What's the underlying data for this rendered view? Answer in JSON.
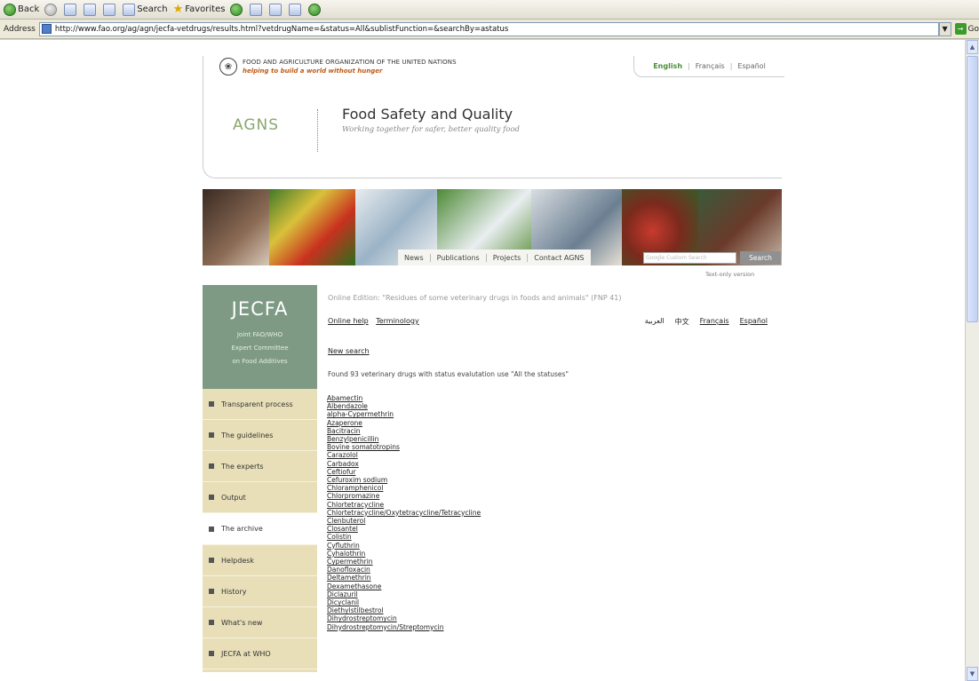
{
  "browser": {
    "back_label": "Back",
    "search_label": "Search",
    "favorites_label": "Favorites",
    "address_label": "Address",
    "url": "http://www.fao.org/ag/agn/jecfa-vetdrugs/results.html?vetdrugName=&status=All&sublistFunction=&searchBy=astatus",
    "go_label": "Go",
    "colors": {
      "toolbar": "#ece9d8",
      "go": "#3b9b2b"
    }
  },
  "header": {
    "org_name": "FOOD AND AGRICULTURE ORGANIZATION OF THE UNITED NATIONS",
    "org_tagline": "helping to build a world without hunger",
    "section_logo": "AGNS",
    "title": "Food Safety and Quality",
    "subtitle": "Working together for safer, better quality food",
    "languages": [
      "English",
      "Français",
      "Español"
    ]
  },
  "nav": {
    "items": [
      "News",
      "Publications",
      "Projects",
      "Contact AGNS"
    ],
    "search_placeholder": "Google Custom Search",
    "search_button": "Search",
    "text_only": "Text-only version"
  },
  "sidebar": {
    "title": "JECFA",
    "subtitle_lines": [
      "Joint FAO/WHO",
      "Expert Committee",
      "on Food Additives"
    ],
    "items": [
      "Transparent process",
      "The guidelines",
      "The experts",
      "Output",
      "The archive",
      "Helpdesk",
      "History",
      "What's new",
      "JECFA at WHO"
    ],
    "active_index": 4,
    "colors": {
      "panel": "#7e9a84",
      "items": "#e8dfb8"
    }
  },
  "content": {
    "edition_title": "Online Edition: \"Residues of some veterinary drugs in foods and animals\" (FNP 41)",
    "help_link": "Online help",
    "terminology_link": "Terminology",
    "language_links": [
      "العربية",
      "中文",
      "Français",
      "Español"
    ],
    "new_search": "New search",
    "found_text": "Found 93 veterinary drugs with status evalutation use \"All the statuses\"",
    "drugs": [
      "Abamectin",
      "Albendazole",
      "alpha-Cypermethrin",
      "Azaperone",
      "Bacitracin",
      "Benzylpenicillin",
      "Bovine somatotropins",
      "Carazolol",
      "Carbadox",
      "Ceftiofur",
      "Cefuroxim sodium",
      "Chloramphenicol",
      "Chlorpromazine",
      "Chlortetracycline",
      "Chlortetracycline/Oxytetracycline/Tetracycline",
      "Clenbuterol",
      "Closantel",
      "Colistin",
      "Cyfluthrin",
      "Cyhalothrin",
      "Cypermethrin",
      "Danofloxacin",
      "Deltamethrin",
      "Dexamethasone",
      "Diclazuril",
      "Dicyclanil",
      "Diethylstilbestrol",
      "Dihydrostreptomycin",
      "Dihydrostreptomycin/Streptomycin"
    ]
  }
}
